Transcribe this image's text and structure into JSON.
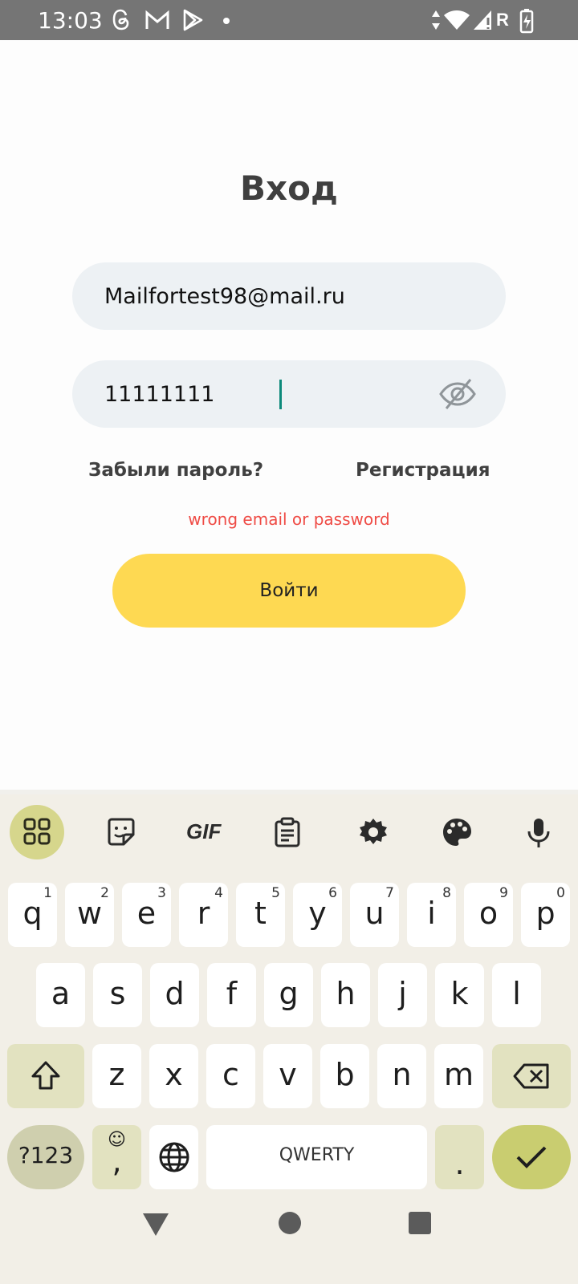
{
  "status_bar": {
    "time": "13:03",
    "network_label": "R",
    "icons": [
      "threads-icon",
      "gmail-icon",
      "play-store-icon",
      "dot-icon",
      "data-arrows-icon",
      "wifi-icon",
      "signal-icon",
      "battery-charging-icon"
    ]
  },
  "login": {
    "title": "Вход",
    "email_value": "Mailfortest98@mail.ru",
    "password_value": "11111111",
    "forgot_link": "Забыли пароль?",
    "register_link": "Регистрация",
    "error_message": "wrong email or password",
    "submit_label": "Войти"
  },
  "keyboard": {
    "toolbar_icons": [
      "apps-grid-icon",
      "sticker-icon",
      "gif-icon",
      "clipboard-icon",
      "settings-gear-icon",
      "palette-icon",
      "microphone-icon"
    ],
    "gif_label": "GIF",
    "row1": [
      {
        "label": "q",
        "hint": "1"
      },
      {
        "label": "w",
        "hint": "2"
      },
      {
        "label": "e",
        "hint": "3"
      },
      {
        "label": "r",
        "hint": "4"
      },
      {
        "label": "t",
        "hint": "5"
      },
      {
        "label": "y",
        "hint": "6"
      },
      {
        "label": "u",
        "hint": "7"
      },
      {
        "label": "i",
        "hint": "8"
      },
      {
        "label": "o",
        "hint": "9"
      },
      {
        "label": "p",
        "hint": "0"
      }
    ],
    "row2": [
      "a",
      "s",
      "d",
      "f",
      "g",
      "h",
      "j",
      "k",
      "l"
    ],
    "row3": [
      "z",
      "x",
      "c",
      "v",
      "b",
      "n",
      "m"
    ],
    "symbols_label": "?123",
    "emoji_comma_label": ",",
    "space_label": "QWERTY",
    "period_label": ".",
    "colors": {
      "accent": "#fed952",
      "error": "#ef4b45",
      "enter_key": "#c9cd70"
    }
  },
  "nav_bar": {
    "icons": [
      "back-triangle-icon",
      "home-circle-icon",
      "recents-square-icon"
    ]
  }
}
